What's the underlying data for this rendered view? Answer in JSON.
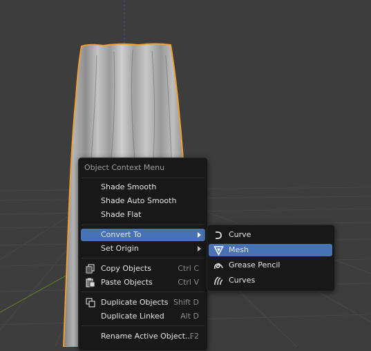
{
  "viewport": {
    "colors": {
      "background": "#3d3d3d",
      "grid": "#484848",
      "x_axis": "#7a3a3a",
      "y_axis": "#5a7a2e",
      "z_axis": "#3a5a8a",
      "selection_outline": "#f0a030"
    }
  },
  "context_menu": {
    "title": "Object Context Menu",
    "items": [
      {
        "label": "Shade Smooth",
        "shortcut": "",
        "icon": "",
        "submenu": false,
        "active": false
      },
      {
        "label": "Shade Auto Smooth",
        "shortcut": "",
        "icon": "",
        "submenu": false,
        "active": false
      },
      {
        "label": "Shade Flat",
        "shortcut": "",
        "icon": "",
        "submenu": false,
        "active": false
      },
      {
        "label": "Convert To",
        "shortcut": "",
        "icon": "",
        "submenu": true,
        "active": true
      },
      {
        "label": "Set Origin",
        "shortcut": "",
        "icon": "",
        "submenu": true,
        "active": false
      },
      {
        "label": "Copy Objects",
        "shortcut": "Ctrl C",
        "icon": "copy-icon",
        "submenu": false,
        "active": false
      },
      {
        "label": "Paste Objects",
        "shortcut": "Ctrl V",
        "icon": "paste-icon",
        "submenu": false,
        "active": false
      },
      {
        "label": "Duplicate Objects",
        "shortcut": "Shift D",
        "icon": "duplicate-icon",
        "submenu": false,
        "active": false
      },
      {
        "label": "Duplicate Linked",
        "shortcut": "Alt D",
        "icon": "",
        "submenu": false,
        "active": false
      },
      {
        "label": "Rename Active Object...",
        "shortcut": "F2",
        "icon": "",
        "submenu": false,
        "active": false
      }
    ],
    "active_color": "#4772b3"
  },
  "convert_submenu": {
    "items": [
      {
        "label": "Curve",
        "icon": "curve-icon",
        "active": false
      },
      {
        "label": "Mesh",
        "icon": "mesh-icon",
        "active": true
      },
      {
        "label": "Grease Pencil",
        "icon": "grease-pencil-icon",
        "active": false
      },
      {
        "label": "Curves",
        "icon": "curves-icon",
        "active": false
      }
    ]
  }
}
